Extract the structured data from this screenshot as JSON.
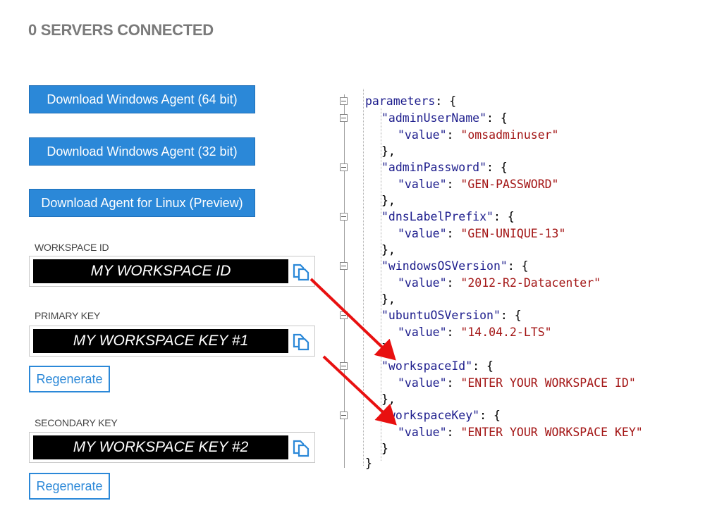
{
  "header": {
    "title": "0 SERVERS CONNECTED"
  },
  "downloads": {
    "win64": "Download Windows Agent (64 bit)",
    "win32": "Download Windows Agent (32 bit)",
    "linux": "Download Agent for Linux (Preview)"
  },
  "workspace_id": {
    "label": "WORKSPACE ID",
    "value": "MY WORKSPACE ID"
  },
  "primary_key": {
    "label": "PRIMARY KEY",
    "value": "MY WORKSPACE KEY #1",
    "regenerate": "Regenerate"
  },
  "secondary_key": {
    "label": "SECONDARY KEY",
    "value": "MY WORKSPACE KEY #2",
    "regenerate": "Regenerate"
  },
  "code": {
    "root_key": "parameters",
    "params": [
      {
        "name": "\"adminUserName\"",
        "value_key": "\"value\"",
        "value": "\"omsadminuser\""
      },
      {
        "name": "\"adminPassword\"",
        "value_key": "\"value\"",
        "value": "\"GEN-PASSWORD\""
      },
      {
        "name": "\"dnsLabelPrefix\"",
        "value_key": "\"value\"",
        "value": "\"GEN-UNIQUE-13\""
      },
      {
        "name": "\"windowsOSVersion\"",
        "value_key": "\"value\"",
        "value": "\"2012-R2-Datacenter\""
      },
      {
        "name": "\"ubuntuOSVersion\"",
        "value_key": "\"value\"",
        "value": "\"14.04.2-LTS\""
      },
      {
        "name": "\"workspaceId\"",
        "value_key": "\"value\"",
        "value": "\"ENTER YOUR WORKSPACE ID\""
      },
      {
        "name": "\"workspaceKey\"",
        "value_key": "\"value\"",
        "value": "\"ENTER YOUR WORKSPACE KEY\""
      }
    ]
  },
  "colors": {
    "accent": "#2b88d8",
    "arrow": "#e81010",
    "code_key": "#1c1c8c",
    "code_string": "#a31515"
  },
  "icons": {
    "copy": "copy-icon",
    "fold": "collapse-icon"
  }
}
